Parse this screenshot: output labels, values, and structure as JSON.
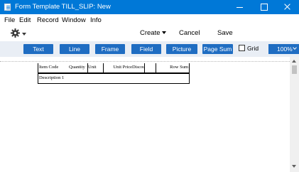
{
  "window": {
    "title": "Form Template TILL_SLIP: New",
    "controls": [
      "minimize",
      "maximize",
      "close"
    ]
  },
  "menu": {
    "items": [
      {
        "label": "File"
      },
      {
        "label": "Edit"
      },
      {
        "label": "Record"
      },
      {
        "label": "Window"
      },
      {
        "label": "Info"
      }
    ]
  },
  "toolbar": {
    "operations_icon": "gear-icon",
    "create_label": "Create",
    "cancel_label": "Cancel",
    "save_label": "Save"
  },
  "ribbon": {
    "buttons": [
      {
        "label": "Text"
      },
      {
        "label": "Line"
      },
      {
        "label": "Frame"
      },
      {
        "label": "Field"
      },
      {
        "label": "Picture"
      },
      {
        "label": "Page Sum"
      }
    ],
    "grid_label": "Grid",
    "grid_checked": false,
    "zoom": "100%"
  },
  "form": {
    "headers": [
      {
        "label": "Item Code"
      },
      {
        "label": "Quantity"
      },
      {
        "label": "Unit"
      },
      {
        "label": "Unit Price"
      },
      {
        "label": "Discou"
      },
      {
        "label": ""
      },
      {
        "label": "Row Sum"
      }
    ],
    "description_label": "Description 1"
  },
  "colors": {
    "titlebar": "#0078d7",
    "button_blue": "#1f6dc2",
    "ribbon_bg": "#e9eef5"
  }
}
